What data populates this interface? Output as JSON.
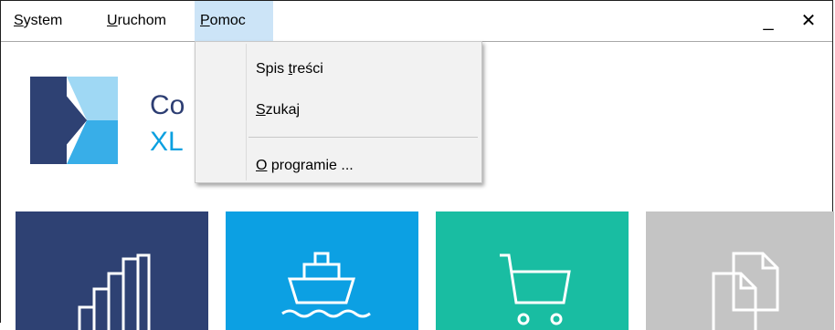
{
  "menubar": {
    "items": [
      {
        "mn": "S",
        "rest": "ystem"
      },
      {
        "mn": "U",
        "rest": "ruchom"
      },
      {
        "mn": "P",
        "rest": "omoc"
      }
    ],
    "minimize": "_",
    "close": "✕"
  },
  "dropdown": {
    "items": [
      {
        "pre": "Spis ",
        "mn": "t",
        "post": "reści"
      },
      {
        "pre": "",
        "mn": "S",
        "post": "zukaj"
      },
      {
        "pre": "",
        "mn": "O",
        "post": " programie ..."
      }
    ]
  },
  "brand": {
    "line1": "Co",
    "line2": "XL"
  },
  "colors": {
    "menu_active": "#cce4f7",
    "tile_navy": "#2e4173",
    "tile_blue": "#0ca0e3",
    "tile_teal": "#19bda2",
    "tile_gray": "#c4c4c4"
  },
  "tiles": [
    {
      "icon": "bar-chart-icon"
    },
    {
      "icon": "ship-icon"
    },
    {
      "icon": "shopping-cart-icon"
    },
    {
      "icon": "documents-icon"
    }
  ]
}
